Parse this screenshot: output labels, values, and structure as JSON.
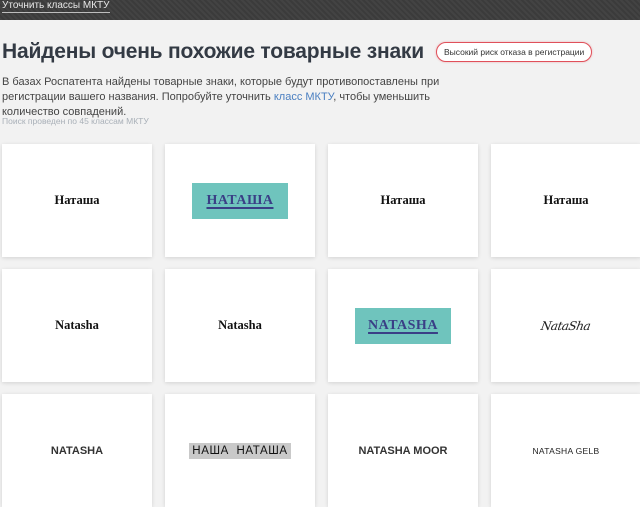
{
  "topbar": {
    "link_label": "Уточнить классы МКТУ"
  },
  "header": {
    "title": "Найдены очень похожие товарные знаки",
    "risk_badge": "Высокий риск отказа в регистрации"
  },
  "description": {
    "part1": "В базах Роспатента найдены товарные знаки, которые будут противопоставлены при регистрации вашего названия. Попробуйте уточнить ",
    "link": "класс МКТУ",
    "part2": ", чтобы уменьшить количество совпадений."
  },
  "search_note": "Поиск проведен по 45 классам МКТУ",
  "colors": {
    "accent_link": "#4a7fc1",
    "risk_border": "#e0505a",
    "teal_logo_bg": "#6fc4bd",
    "teal_logo_text": "#3a3f86",
    "topbar_bg": "#3d3d3d"
  },
  "trademarks": [
    {
      "text": "Наташа",
      "style": "serif-bold"
    },
    {
      "text": "НАТАША",
      "style": "teal-logo"
    },
    {
      "text": "Наташа",
      "style": "serif-bold"
    },
    {
      "text": "Наташа",
      "style": "serif-bold"
    },
    {
      "text": "Natasha",
      "style": "serif-bold"
    },
    {
      "text": "Natasha",
      "style": "serif-bold"
    },
    {
      "text": "NATASHA",
      "style": "teal-logo"
    },
    {
      "text": "NataSha",
      "style": "script"
    },
    {
      "text": "NATASHA",
      "style": "sans-bold"
    },
    {
      "text": "НАША  НАТАША",
      "style": "gray-logo"
    },
    {
      "text": "NATASHA MOOR",
      "style": "sans-bold"
    },
    {
      "text": "NATASHA GELB",
      "style": "sans-light"
    }
  ]
}
